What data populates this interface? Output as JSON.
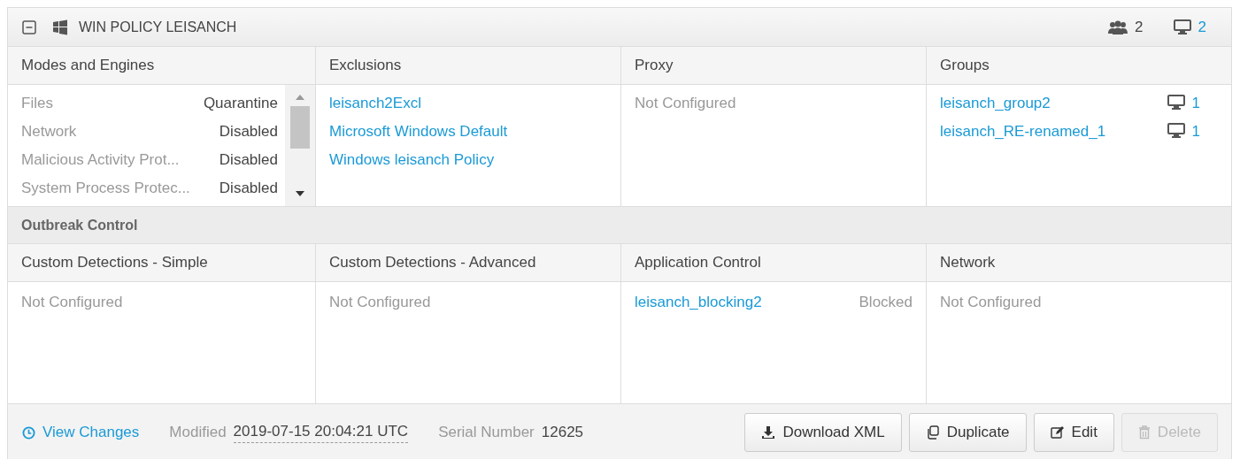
{
  "header": {
    "title": "WIN POLICY LEISANCH",
    "group_count": "2",
    "computer_count": "2"
  },
  "top_columns": [
    {
      "heading": "Modes and Engines",
      "kind": "modes",
      "rows": [
        {
          "label": "Files",
          "value": "Quarantine"
        },
        {
          "label": "Network",
          "value": "Disabled"
        },
        {
          "label": "Malicious Activity Prot...",
          "value": "Disabled"
        },
        {
          "label": "System Process Protec...",
          "value": "Disabled"
        }
      ]
    },
    {
      "heading": "Exclusions",
      "kind": "links",
      "items": [
        "leisanch2Excl",
        "Microsoft Windows Default",
        "Windows leisanch Policy"
      ]
    },
    {
      "heading": "Proxy",
      "kind": "text",
      "text": "Not Configured"
    },
    {
      "heading": "Groups",
      "kind": "groups",
      "items": [
        {
          "name": "leisanch_group2",
          "count": "1"
        },
        {
          "name": "leisanch_RE-renamed_1",
          "count": "1"
        }
      ]
    }
  ],
  "outbreak_title": "Outbreak Control",
  "bottom_columns": [
    {
      "heading": "Custom Detections - Simple",
      "kind": "text",
      "text": "Not Configured"
    },
    {
      "heading": "Custom Detections - Advanced",
      "kind": "text",
      "text": "Not Configured"
    },
    {
      "heading": "Application Control",
      "kind": "apps",
      "items": [
        {
          "name": "leisanch_blocking2",
          "status": "Blocked"
        }
      ]
    },
    {
      "heading": "Network",
      "kind": "text",
      "text": "Not Configured"
    }
  ],
  "footer": {
    "view_changes": "View Changes",
    "modified_label": "Modified",
    "modified_value": "2019-07-15 20:04:21 UTC",
    "serial_label": "Serial Number",
    "serial_value": "12625",
    "buttons": [
      {
        "kind": "download",
        "label": "Download XML",
        "disabled": false
      },
      {
        "kind": "duplicate",
        "label": "Duplicate",
        "disabled": false
      },
      {
        "kind": "edit",
        "label": "Edit",
        "disabled": false
      },
      {
        "kind": "delete",
        "label": "Delete",
        "disabled": true
      }
    ]
  }
}
